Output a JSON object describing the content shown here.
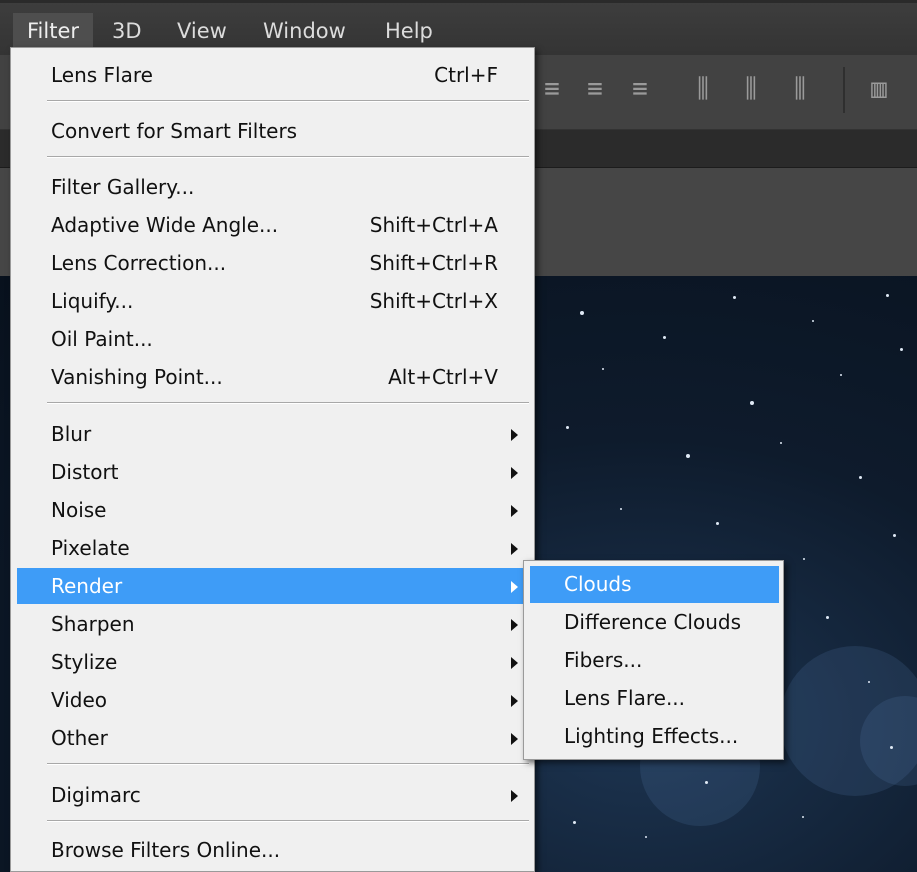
{
  "menubar": {
    "items": [
      {
        "label": "Filter"
      },
      {
        "label": "3D"
      },
      {
        "label": "View"
      },
      {
        "label": "Window"
      },
      {
        "label": "Help"
      }
    ]
  },
  "filter_menu": {
    "lens_flare": {
      "label": "Lens Flare",
      "shortcut": "Ctrl+F"
    },
    "convert_smart": {
      "label": "Convert for Smart Filters"
    },
    "filter_gallery": {
      "label": "Filter Gallery..."
    },
    "adaptive_wide_angle": {
      "label": "Adaptive Wide Angle...",
      "shortcut": "Shift+Ctrl+A"
    },
    "lens_correction": {
      "label": "Lens Correction...",
      "shortcut": "Shift+Ctrl+R"
    },
    "liquify": {
      "label": "Liquify...",
      "shortcut": "Shift+Ctrl+X"
    },
    "oil_paint": {
      "label": "Oil Paint..."
    },
    "vanishing_point": {
      "label": "Vanishing Point...",
      "shortcut": "Alt+Ctrl+V"
    },
    "blur": {
      "label": "Blur"
    },
    "distort": {
      "label": "Distort"
    },
    "noise": {
      "label": "Noise"
    },
    "pixelate": {
      "label": "Pixelate"
    },
    "render": {
      "label": "Render"
    },
    "sharpen": {
      "label": "Sharpen"
    },
    "stylize": {
      "label": "Stylize"
    },
    "video": {
      "label": "Video"
    },
    "other": {
      "label": "Other"
    },
    "digimarc": {
      "label": "Digimarc"
    },
    "browse_online": {
      "label": "Browse Filters Online..."
    }
  },
  "render_submenu": {
    "items": [
      {
        "label": "Clouds"
      },
      {
        "label": "Difference Clouds"
      },
      {
        "label": "Fibers..."
      },
      {
        "label": "Lens Flare..."
      },
      {
        "label": "Lighting Effects..."
      }
    ]
  },
  "colors": {
    "highlight": "#3e9cf7",
    "menu_bg": "#f0f0f0",
    "menubar_bg": "#3a3a3a"
  }
}
